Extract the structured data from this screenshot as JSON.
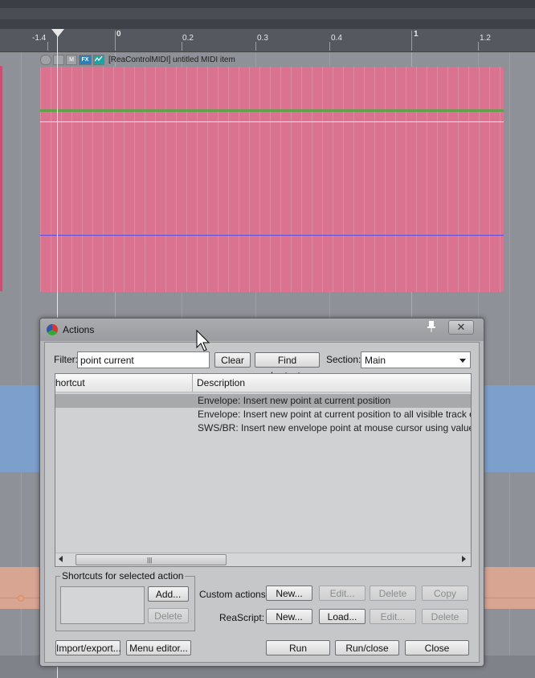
{
  "ruler": {
    "labels": [
      "-1.4",
      "0",
      "0.2",
      "0.3",
      "0.4",
      "1",
      "1.2"
    ]
  },
  "midi_item": {
    "header_buttons": [
      "M",
      "FX"
    ],
    "title": "[ReaControlMIDI] untitled MIDI item"
  },
  "dialog": {
    "title": "Actions",
    "pin_icon": "pin-icon",
    "close_label": "✕",
    "filter": {
      "label": "Filter:",
      "value": "point current"
    },
    "clear_label": "Clear",
    "find_shortcut_label": "Find shortcut...",
    "section": {
      "label": "Section:",
      "value": "Main"
    },
    "table": {
      "columns": [
        "hortcut",
        "Description"
      ],
      "rows": [
        {
          "shortcut": "",
          "description": "Envelope: Insert new point at current position",
          "selected": true
        },
        {
          "shortcut": "",
          "description": "Envelope: Insert new point at current position to all visible track envelope",
          "selected": false
        },
        {
          "shortcut": "",
          "description": "SWS/BR: Insert new envelope point at mouse cursor using value at curr",
          "selected": false
        }
      ]
    },
    "shortcuts_group": {
      "title": "Shortcuts for selected action",
      "add_label": "Add...",
      "delete_label": "Delete"
    },
    "custom_actions": {
      "label": "Custom actions:",
      "new_label": "New...",
      "edit_label": "Edit...",
      "delete_label": "Delete",
      "copy_label": "Copy"
    },
    "reascript": {
      "label": "ReaScript:",
      "new_label": "New...",
      "load_label": "Load...",
      "edit_label": "Edit...",
      "delete_label": "Delete"
    },
    "footer": {
      "import_export_label": "Import/export...",
      "menu_editor_label": "Menu editor...",
      "run_label": "Run",
      "run_close_label": "Run/close",
      "close_label": "Close"
    }
  },
  "colors": {
    "midi_item": "#d9738f",
    "midi_green_lane": "#5ea14a",
    "blue_track": "#7d9fcc",
    "orange_track": "#d9a593",
    "dialog_bg": "#c6c7c9",
    "selected_row": "#a8a9ab"
  }
}
